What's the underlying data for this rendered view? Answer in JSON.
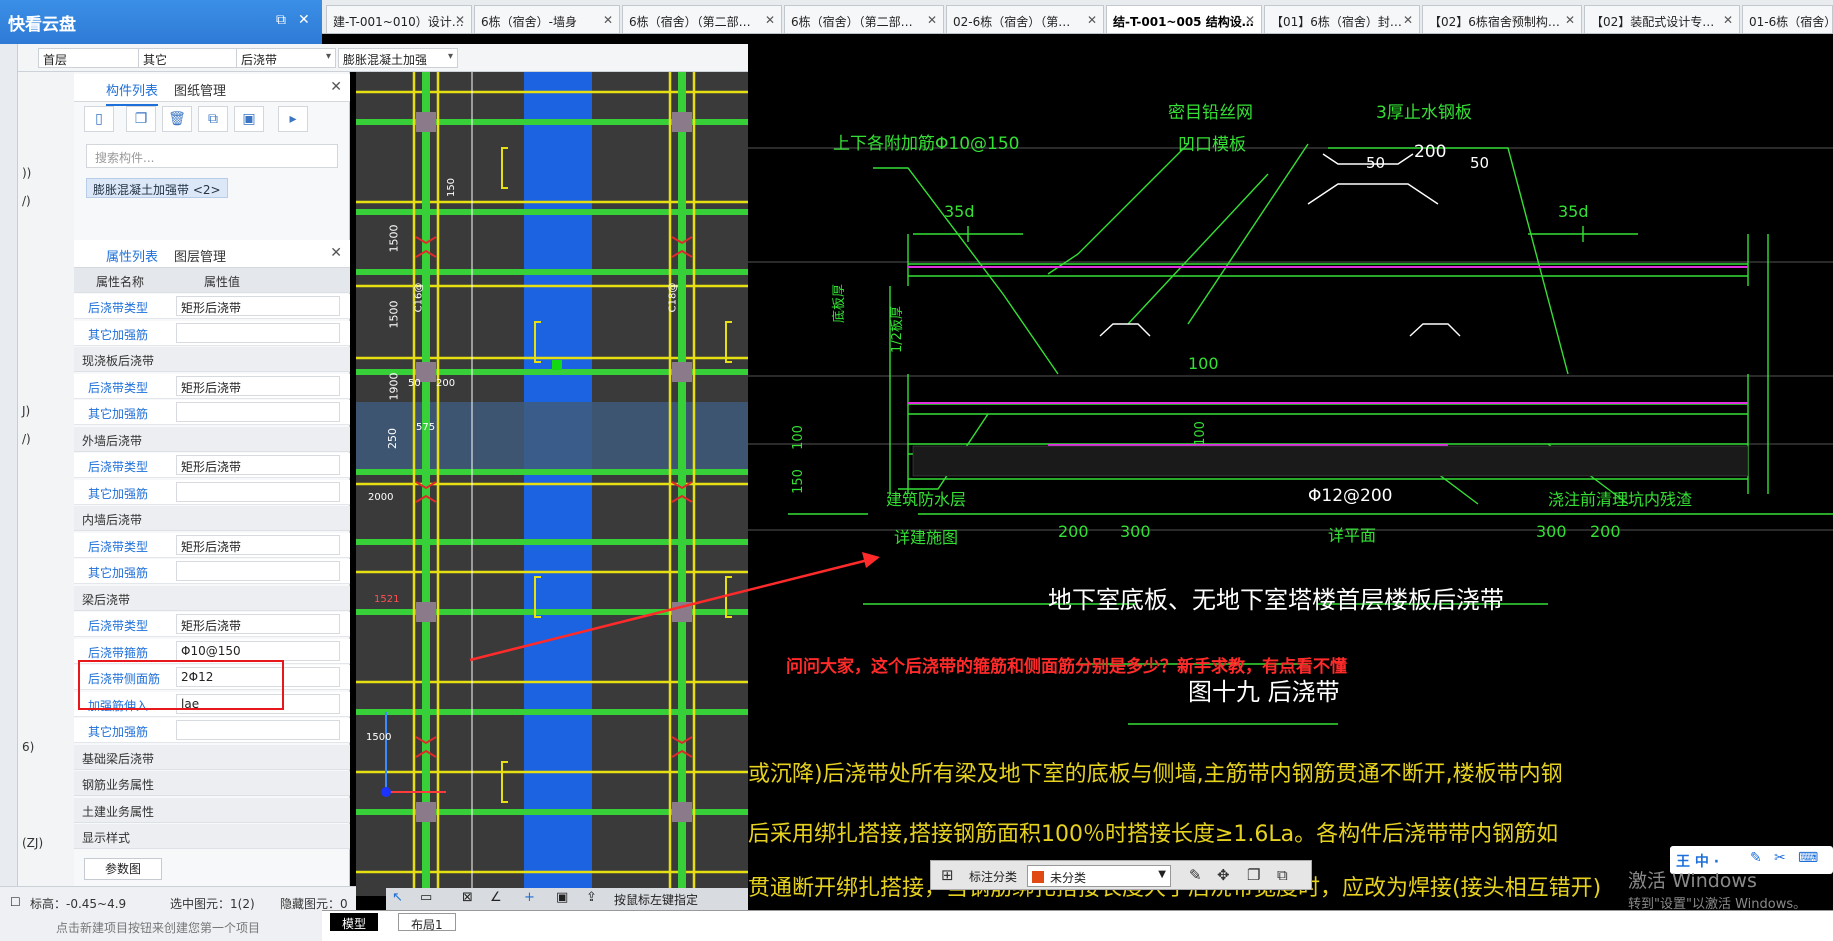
{
  "app": {
    "title": "快看云盘"
  },
  "doc_tabs": [
    {
      "label": "建-T-001~010）设计…",
      "active": false
    },
    {
      "label": "6栋（宿舍）-墙身",
      "active": false
    },
    {
      "label": "6栋（宿舍）（第二部…",
      "active": false
    },
    {
      "label": "6栋（宿舍）（第二部…",
      "active": false
    },
    {
      "label": "02-6栋（宿舍）（第…",
      "active": false
    },
    {
      "label": "结-T-001~005 结构设…",
      "active": true
    },
    {
      "label": "【01】6栋（宿舍）封…",
      "active": false
    },
    {
      "label": "【02】6栋宿舍预制构…",
      "active": false
    },
    {
      "label": "【02】装配式设计专…",
      "active": false
    },
    {
      "label": "01-6栋（宿舍）",
      "active": false
    }
  ],
  "combos": [
    "首层",
    "其它",
    "后浇带",
    "膨胀混凝土加强"
  ],
  "left_layer_list": [
    "))",
    "/)",
    "J)",
    "/)",
    "6)",
    "(ZJ)"
  ],
  "component_panel": {
    "tabs": [
      "构件列表",
      "图纸管理"
    ],
    "search_placeholder": "搜索构件...",
    "selected_item": "膨胀混凝土加强带 <2>"
  },
  "property_panel": {
    "tabs": [
      "属性列表",
      "图层管理"
    ],
    "headers": [
      "属性名称",
      "属性值"
    ],
    "rows": [
      {
        "kind": "prop",
        "name": "后浇带类型",
        "value": "矩形后浇带"
      },
      {
        "kind": "prop",
        "name": "其它加强筋",
        "value": ""
      },
      {
        "kind": "group",
        "name": "现浇板后浇带"
      },
      {
        "kind": "prop",
        "name": "后浇带类型",
        "value": "矩形后浇带"
      },
      {
        "kind": "prop",
        "name": "其它加强筋",
        "value": ""
      },
      {
        "kind": "group",
        "name": "外墙后浇带"
      },
      {
        "kind": "prop",
        "name": "后浇带类型",
        "value": "矩形后浇带"
      },
      {
        "kind": "prop",
        "name": "其它加强筋",
        "value": ""
      },
      {
        "kind": "group",
        "name": "内墙后浇带"
      },
      {
        "kind": "prop",
        "name": "后浇带类型",
        "value": "矩形后浇带"
      },
      {
        "kind": "prop",
        "name": "其它加强筋",
        "value": ""
      },
      {
        "kind": "group",
        "name": "梁后浇带"
      },
      {
        "kind": "prop",
        "name": "后浇带类型",
        "value": "矩形后浇带"
      },
      {
        "kind": "prop",
        "name": "后浇带箍筋",
        "value": "Φ10@150"
      },
      {
        "kind": "prop",
        "name": "后浇带侧面筋",
        "value": "2Φ12"
      },
      {
        "kind": "prop",
        "name": "加强筋伸入...",
        "value": "lae"
      },
      {
        "kind": "prop",
        "name": "其它加强筋",
        "value": ""
      },
      {
        "kind": "group",
        "name": "基础梁后浇带"
      },
      {
        "kind": "group",
        "name": "钢筋业务属性"
      },
      {
        "kind": "group",
        "name": "土建业务属性"
      },
      {
        "kind": "group",
        "name": "显示样式"
      }
    ],
    "button": "参数图"
  },
  "status": {
    "elevation": "标高：-0.45~4.9",
    "selected": "选中图元：1(2)",
    "hidden": "隐藏图元：0",
    "hint": "点击新建项目按钮来创建您第一个项目"
  },
  "bottom_tabs": [
    "模型",
    "布局1"
  ],
  "float_toolbar": {
    "label": "标注分类",
    "value": "未分类",
    "swatch": "#e04a12"
  },
  "cad_toolbar": {
    "snap_hint": "按鼠标左键指定"
  },
  "drawing_dims": [
    "1500",
    "1500",
    "1900",
    "250",
    "2000",
    "1500",
    "50",
    "200"
  ],
  "drawing_labels": [
    "C16@",
    "C18@",
    "150",
    "575",
    "1521"
  ],
  "cad_text": {
    "top_label1": "上下各附加筋Φ10@150",
    "top_label2": "密目铅丝网",
    "top_label3": "凹口模板",
    "top_label4": "3厚止水钢板",
    "dim_50a": "50",
    "dim_200": "200",
    "dim_50b": "50",
    "d35a": "35d",
    "d35b": "35d",
    "side1": "底板厚",
    "side2": "1/2板厚",
    "d100": "100",
    "d100b": "100",
    "d100c": "100",
    "d150": "150",
    "waterproof": "建筑防水层",
    "detail": "详建施图",
    "rebar": "Φ12@200",
    "clean": "浇注前清理坑内残渣",
    "b200a": "200",
    "b300a": "300",
    "bplan": "详平面",
    "b300b": "300",
    "b200b": "200",
    "title1": "地下室底板、无地下室塔楼首层楼板后浇带",
    "question": "问问大家，这个后浇带的箍筋和侧面筋分别是多少？新手求教，有点看不懂",
    "fig_title": "图十九 后浇带",
    "note1": "或沉降)后浇带处所有梁及地下室的底板与侧墙,主筋带内钢筋贯通不断开,楼板带内钢",
    "note2": "后采用绑扎搭接,搭接钢筋面积100％时搭接长度≥1.6La。各构件后浇带带内钢筋如",
    "note3": "贯通断开绑扎搭接，当钢筋绑扎搭接长度大于后浇带宽度时，应改为焊接(接头相互错开)"
  },
  "ime": {
    "label": "王 中 ·"
  },
  "watermark": {
    "line1": "激活 Windows",
    "line2": "转到\"设置\"以激活 Windows。"
  },
  "colors": {
    "accent": "#1e6fd9",
    "cad_green": "#35e035",
    "cad_yellow": "#e6d21e",
    "cad_magenta": "#e030e0",
    "annotation_red": "#ff2a2a"
  }
}
